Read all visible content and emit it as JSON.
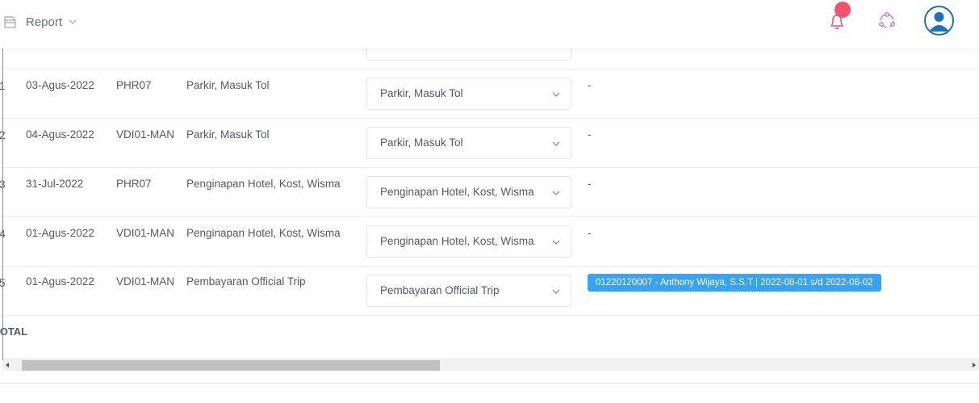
{
  "topbar": {
    "report_label": "Report",
    "icons": {
      "report": "document-icon",
      "notifications": "bell-icon",
      "share": "share-icon",
      "user": "user-avatar-icon"
    },
    "notification_dot_color": "#f4516c"
  },
  "table": {
    "rows": [
      {
        "no": "1",
        "date": "03-Agus-2022",
        "code": "PHR07",
        "description": "Parkir, Masuk Tol",
        "category": "Parkir, Masuk Tol",
        "note": "-"
      },
      {
        "no": "2",
        "date": "04-Agus-2022",
        "code": "VDI01-MAN",
        "description": "Parkir, Masuk Tol",
        "category": "Parkir, Masuk Tol",
        "note": "-"
      },
      {
        "no": "3",
        "date": "31-Jul-2022",
        "code": "PHR07",
        "description": "Penginapan Hotel, Kost, Wisma",
        "category": "Penginapan Hotel, Kost, Wisma",
        "note": "-"
      },
      {
        "no": "4",
        "date": "01-Agus-2022",
        "code": "VDI01-MAN",
        "description": "Penginapan Hotel, Kost, Wisma",
        "category": "Penginapan Hotel, Kost, Wisma",
        "note": "-"
      },
      {
        "no": "5",
        "date": "01-Agus-2022",
        "code": "VDI01-MAN",
        "description": "Pembayaran Official Trip",
        "category": "Pembayaran Official Trip",
        "badge": "01220120007 - Anthony Wijaya, S.S.T | 2022-08-01 s/d 2022-08-02"
      }
    ],
    "total_label": "TOTAL",
    "badge_color": "#36a3f7"
  }
}
